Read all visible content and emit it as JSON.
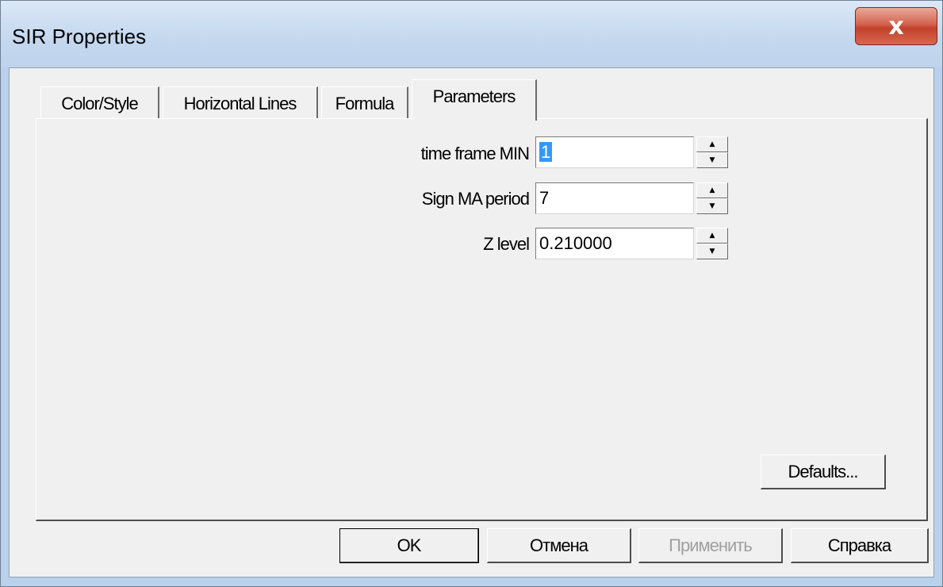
{
  "window": {
    "title": "SIR Properties",
    "close_glyph": "x"
  },
  "tabs": [
    {
      "label": "Color/Style",
      "active": false
    },
    {
      "label": "Horizontal Lines",
      "active": false
    },
    {
      "label": "Formula",
      "active": false
    },
    {
      "label": "Parameters",
      "active": true
    }
  ],
  "parameters": [
    {
      "label": "time frame MIN",
      "value": "1",
      "selected": true
    },
    {
      "label": "Sign MA period",
      "value": "7",
      "selected": false
    },
    {
      "label": "Z level",
      "value": "0.210000",
      "selected": false
    }
  ],
  "spinner": {
    "up_glyph": "▲",
    "down_glyph": "▼"
  },
  "panel": {
    "defaults_label": "Defaults..."
  },
  "footer": {
    "ok_label": "OK",
    "cancel_label": "Отмена",
    "apply_label": "Применить",
    "help_label": "Справка"
  },
  "colors": {
    "titlebar": "#c3d7ee",
    "close_button": "#c2412b",
    "dialog_face": "#f0f0f0",
    "selection": "#3399ff"
  },
  "icons": {
    "close": "close-icon"
  }
}
